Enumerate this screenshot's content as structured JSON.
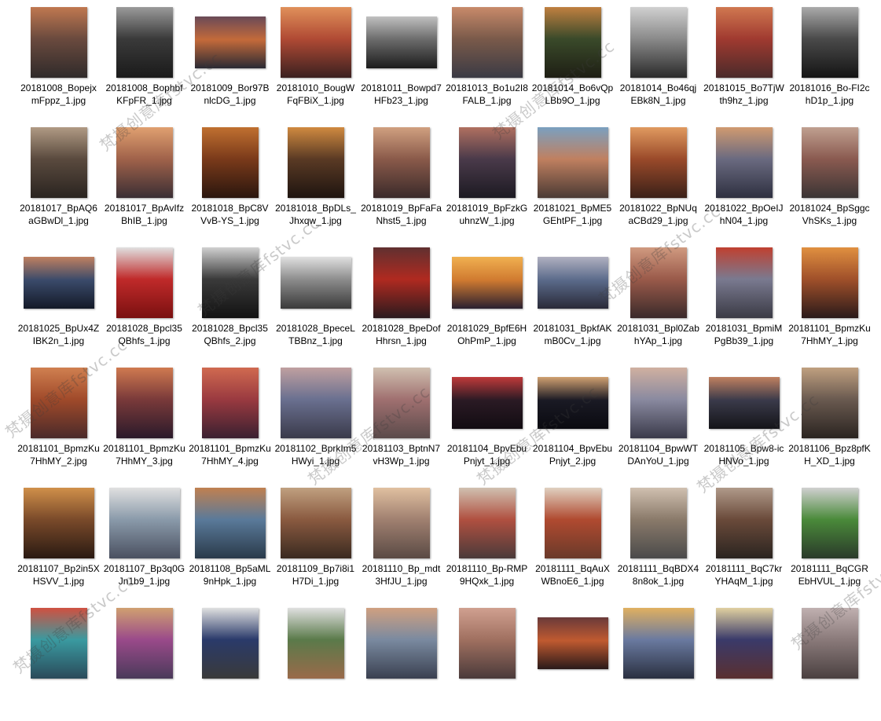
{
  "watermark": "梵摄创意库fstvc.cc",
  "files": [
    {
      "name": "20181008_BopejxmFppz_1.jpg",
      "shape": "p",
      "colors": [
        "#6a4a3e",
        "#c07850",
        "#2f2a2a"
      ]
    },
    {
      "name": "20181008_BophbfKFpFR_1.jpg",
      "shape": "p",
      "colors": [
        "#3a3a3a",
        "#9a9a9a",
        "#1a1a1a"
      ]
    },
    {
      "name": "20181009_Bor97BnlcDG_1.jpg",
      "shape": "l",
      "colors": [
        "#c46a3a",
        "#6a4a58",
        "#2a2a34"
      ]
    },
    {
      "name": "20181010_BougWFqFBiX_1.jpg",
      "shape": "s",
      "colors": [
        "#b04a34",
        "#e0905a",
        "#3a2020"
      ]
    },
    {
      "name": "20181011_Bowpd7HFb23_1.jpg",
      "shape": "l",
      "colors": [
        "#6a6a6a",
        "#c0c0c0",
        "#1c1c1c"
      ]
    },
    {
      "name": "20181013_Bo1u2I8FALB_1.jpg",
      "shape": "s",
      "colors": [
        "#7a5a4a",
        "#c88a6a",
        "#3a3a44"
      ]
    },
    {
      "name": "20181014_Bo6vQpLBb9O_1.jpg",
      "shape": "p",
      "colors": [
        "#3a4a2a",
        "#c08040",
        "#1e1e14"
      ]
    },
    {
      "name": "20181014_Bo46qjEBk8N_1.jpg",
      "shape": "p",
      "colors": [
        "#8a8a8a",
        "#d0d0d0",
        "#2a2a2a"
      ]
    },
    {
      "name": "20181015_Bo7TjWth9hz_1.jpg",
      "shape": "p",
      "colors": [
        "#a03a30",
        "#d07850",
        "#4a2a2a"
      ]
    },
    {
      "name": "20181016_Bo-FI2chD1p_1.jpg",
      "shape": "p",
      "colors": [
        "#4a4a4a",
        "#aaaaaa",
        "#141414"
      ]
    },
    {
      "name": "20181017_BpAQ6aGBwDl_1.jpg",
      "shape": "p",
      "colors": [
        "#5a4a3e",
        "#b09a84",
        "#2a2420"
      ]
    },
    {
      "name": "20181017_BpAvIfzBhIB_1.jpg",
      "shape": "p",
      "colors": [
        "#a0624a",
        "#e0a070",
        "#3a2e34"
      ]
    },
    {
      "name": "20181018_BpC8VVvB-YS_1.jpg",
      "shape": "p",
      "colors": [
        "#7a3a1a",
        "#c07030",
        "#2a160e"
      ]
    },
    {
      "name": "20181018_BpDLs_Jhxqw_1.jpg",
      "shape": "p",
      "colors": [
        "#5a3a24",
        "#d08a40",
        "#1e1410"
      ]
    },
    {
      "name": "20181019_BpFaFaNhst5_1.jpg",
      "shape": "p",
      "colors": [
        "#8a5a4a",
        "#d0a080",
        "#3a2a2a"
      ]
    },
    {
      "name": "20181019_BpFzkGuhnzW_1.jpg",
      "shape": "p",
      "colors": [
        "#4a3a4a",
        "#b07060",
        "#1c1a22"
      ]
    },
    {
      "name": "20181021_BpME5GEhtPF_1.jpg",
      "shape": "s",
      "colors": [
        "#c08060",
        "#7aa0c0",
        "#4a3a34"
      ]
    },
    {
      "name": "20181022_BpNUqaCBd29_1.jpg",
      "shape": "p",
      "colors": [
        "#9a4a2a",
        "#e09a60",
        "#3a2018"
      ]
    },
    {
      "name": "20181022_BpOeIJhN04_1.jpg",
      "shape": "p",
      "colors": [
        "#6a6a80",
        "#d09a70",
        "#2e3040"
      ]
    },
    {
      "name": "20181024_BpSggcVhSKs_1.jpg",
      "shape": "p",
      "colors": [
        "#8a5a50",
        "#c0a090",
        "#3a3434"
      ]
    },
    {
      "name": "20181025_BpUx4ZIBK2n_1.jpg",
      "shape": "l",
      "colors": [
        "#3a4a6a",
        "#c08060",
        "#141a28"
      ]
    },
    {
      "name": "20181028_Bpcl35QBhfs_1.jpg",
      "shape": "p",
      "colors": [
        "#c02a2a",
        "#e0e0e0",
        "#7a1010"
      ]
    },
    {
      "name": "20181028_Bpcl35QBhfs_2.jpg",
      "shape": "p",
      "colors": [
        "#3a3a3a",
        "#d0d0d0",
        "#121212"
      ]
    },
    {
      "name": "20181028_BpeceLTBBnz_1.jpg",
      "shape": "l",
      "colors": [
        "#8a8a8a",
        "#e0e0e0",
        "#3a3a3a"
      ]
    },
    {
      "name": "20181028_BpeDofHhrsn_1.jpg",
      "shape": "p",
      "colors": [
        "#b02a20",
        "#603030",
        "#2a1a1e"
      ]
    },
    {
      "name": "20181029_BpfE6HOhPmP_1.jpg",
      "shape": "l",
      "colors": [
        "#d07a30",
        "#f0b050",
        "#2a2030"
      ]
    },
    {
      "name": "20181031_BpkfAKmB0Cv_1.jpg",
      "shape": "l",
      "colors": [
        "#5a6a8a",
        "#b0b0c0",
        "#2a2a38"
      ]
    },
    {
      "name": "20181031_Bpl0ZabhYAp_1.jpg",
      "shape": "p",
      "colors": [
        "#9a5a4a",
        "#d09a80",
        "#3a2a2a"
      ]
    },
    {
      "name": "20181031_BpmiMPgBb39_1.jpg",
      "shape": "p",
      "colors": [
        "#7a7a90",
        "#c04030",
        "#3a3a44"
      ]
    },
    {
      "name": "20181101_BpmzKu7HhMY_1.jpg",
      "shape": "p",
      "colors": [
        "#a0502a",
        "#e09040",
        "#2a1a1a"
      ]
    },
    {
      "name": "20181101_BpmzKu7HhMY_2.jpg",
      "shape": "p",
      "colors": [
        "#a04a2a",
        "#d08050",
        "#4a2a2a"
      ]
    },
    {
      "name": "20181101_BpmzKu7HhMY_3.jpg",
      "shape": "p",
      "colors": [
        "#7a3a3a",
        "#d07a50",
        "#2a1a2a"
      ]
    },
    {
      "name": "20181101_BpmzKu7HhMY_4.jpg",
      "shape": "p",
      "colors": [
        "#9a3a40",
        "#d06a50",
        "#3a2030"
      ]
    },
    {
      "name": "20181102_BprkIm5HWyi_1.jpg",
      "shape": "s",
      "colors": [
        "#6a7090",
        "#c0a0a0",
        "#3a3a4a"
      ]
    },
    {
      "name": "20181103_BptnN7vH3Wp_1.jpg",
      "shape": "p",
      "colors": [
        "#a07070",
        "#d0c0b0",
        "#5a4a4a"
      ]
    },
    {
      "name": "20181104_BpvEbuPnjyt_1.jpg",
      "shape": "l",
      "colors": [
        "#2a1a24",
        "#c03a3a",
        "#120c12"
      ]
    },
    {
      "name": "20181104_BpvEbuPnjyt_2.jpg",
      "shape": "l",
      "colors": [
        "#1a1a24",
        "#d0a070",
        "#0a0a10"
      ]
    },
    {
      "name": "20181104_BpwWTDAnYoU_1.jpg",
      "shape": "p",
      "colors": [
        "#8a8aa0",
        "#d0b0a0",
        "#3a3a4a"
      ]
    },
    {
      "name": "20181105_Bpw8-icHNVo_1.jpg",
      "shape": "l",
      "colors": [
        "#3a3a4a",
        "#c08060",
        "#141418"
      ]
    },
    {
      "name": "20181106_Bpz8pfKH_XD_1.jpg",
      "shape": "p",
      "colors": [
        "#6a5a50",
        "#c0a080",
        "#2a2420"
      ]
    },
    {
      "name": "20181107_Bp2in5XHSVV_1.jpg",
      "shape": "s",
      "colors": [
        "#7a4a2a",
        "#d0904a",
        "#2a1a12"
      ]
    },
    {
      "name": "20181107_Bp3q0GJn1b9_1.jpg",
      "shape": "s",
      "colors": [
        "#8a9aaa",
        "#e0e0e0",
        "#4a5060"
      ]
    },
    {
      "name": "20181108_Bp5aML9nHpk_1.jpg",
      "shape": "s",
      "colors": [
        "#5a7a9a",
        "#c08050",
        "#2a3a4a"
      ]
    },
    {
      "name": "20181109_Bp7i8i1H7Di_1.jpg",
      "shape": "s",
      "colors": [
        "#8a5a40",
        "#c0a080",
        "#3a2a20"
      ]
    },
    {
      "name": "20181110_Bp_mdt3HfJU_1.jpg",
      "shape": "p",
      "colors": [
        "#a08070",
        "#e0c0a0",
        "#5a4a44"
      ]
    },
    {
      "name": "20181110_Bp-RMP9HQxk_1.jpg",
      "shape": "p",
      "colors": [
        "#b05040",
        "#d0c0b0",
        "#4a3a3a"
      ]
    },
    {
      "name": "20181111_BqAuXWBnoE6_1.jpg",
      "shape": "p",
      "colors": [
        "#b04a30",
        "#e0d0c0",
        "#6a3a2a"
      ]
    },
    {
      "name": "20181111_BqBDX48n8ok_1.jpg",
      "shape": "p",
      "colors": [
        "#8a7a6a",
        "#d0c0b0",
        "#4a4a4a"
      ]
    },
    {
      "name": "20181111_BqC7krYHAqM_1.jpg",
      "shape": "p",
      "colors": [
        "#6a4a3a",
        "#b09a8a",
        "#2a2420"
      ]
    },
    {
      "name": "20181111_BqCGREbHVUL_1.jpg",
      "shape": "p",
      "colors": [
        "#4a8a3a",
        "#d0d0d0",
        "#2a3a2a"
      ]
    },
    {
      "name": "",
      "shape": "p",
      "colors": [
        "#3a9aa0",
        "#d05040",
        "#2a4a5a"
      ]
    },
    {
      "name": "",
      "shape": "p",
      "colors": [
        "#9a4a8a",
        "#d0a070",
        "#4a3a5a"
      ]
    },
    {
      "name": "",
      "shape": "p",
      "colors": [
        "#2a3a6a",
        "#e0e0e0",
        "#3a3a3a"
      ]
    },
    {
      "name": "",
      "shape": "p",
      "colors": [
        "#5a7a4a",
        "#e0e0e0",
        "#9a6a4a"
      ]
    },
    {
      "name": "",
      "shape": "s",
      "colors": [
        "#7a8aa0",
        "#d0a080",
        "#3a4050"
      ]
    },
    {
      "name": "",
      "shape": "p",
      "colors": [
        "#a07060",
        "#d0a090",
        "#4a3a3a"
      ]
    },
    {
      "name": "",
      "shape": "l",
      "colors": [
        "#c05a30",
        "#6a3a3a",
        "#2a1a1a"
      ]
    },
    {
      "name": "",
      "shape": "s",
      "colors": [
        "#6a7aa0",
        "#e0b060",
        "#2a3040"
      ]
    },
    {
      "name": "",
      "shape": "p",
      "colors": [
        "#3a3a6a",
        "#e0d0a0",
        "#5a3030"
      ]
    },
    {
      "name": "",
      "shape": "p",
      "colors": [
        "#8a7a7a",
        "#c0b0b0",
        "#4a4040"
      ]
    }
  ]
}
